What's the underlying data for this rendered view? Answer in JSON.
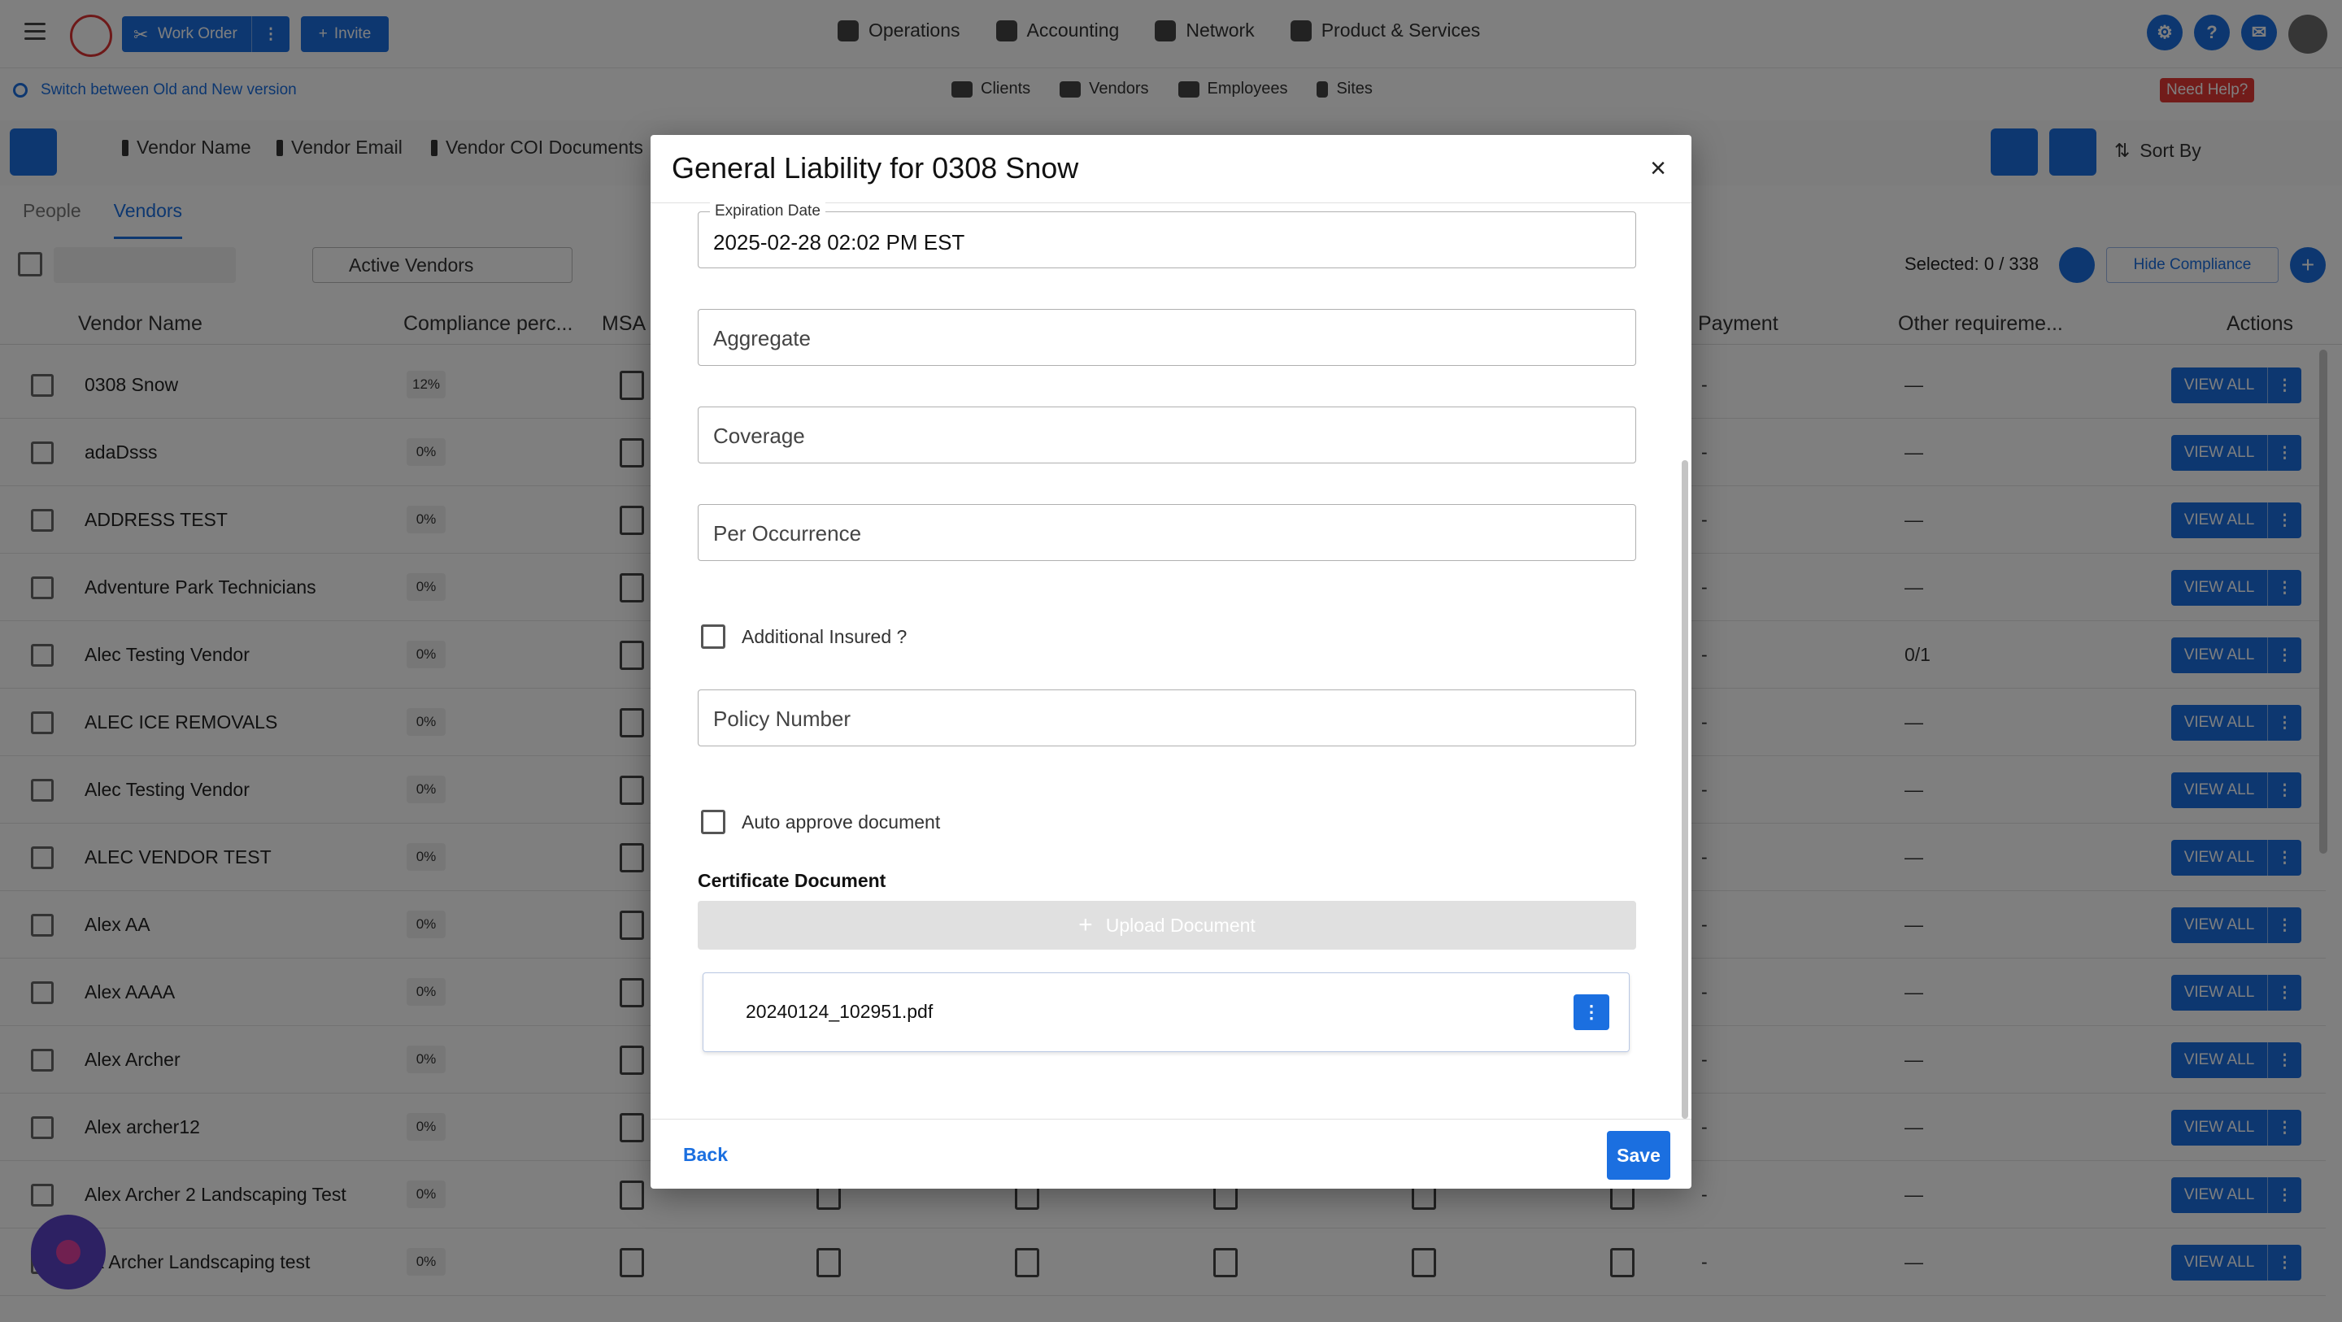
{
  "header": {
    "work_order_label": "Work Order",
    "work_order_menu": "⋮",
    "invite_label": "Invite",
    "nav": [
      {
        "label": "Operations",
        "icon": "clipboard-icon"
      },
      {
        "label": "Accounting",
        "icon": "ledger-icon"
      },
      {
        "label": "Network",
        "icon": "network-icon"
      },
      {
        "label": "Product & Services",
        "icon": "briefcase-icon"
      }
    ],
    "help_label": "?"
  },
  "switch_label": "Switch between Old and New version",
  "subnav": [
    "Clients",
    "Vendors",
    "Employees",
    "Sites"
  ],
  "need_help": "Need Help?",
  "pinned_columns": [
    "Vendor Name",
    "Vendor Email",
    "Vendor COI Documents"
  ],
  "sort_by": "Sort By",
  "tabs": [
    "People",
    "Vendors"
  ],
  "filter": {
    "active_vendors": "Active Vendors",
    "selected": "Selected: 0 / 338",
    "hide_compliance": "Hide Compliance"
  },
  "table": {
    "headers": {
      "vendor_name": "Vendor Name",
      "compliance": "Compliance perc...",
      "msa": "MSA",
      "payment": "Payment",
      "other": "Other requireme...",
      "actions": "Actions"
    },
    "view_all": "VIEW ALL",
    "rows": [
      {
        "name": "0308 Snow",
        "pct": "12%",
        "other": "—"
      },
      {
        "name": "adaDsss",
        "pct": "0%",
        "other": "—"
      },
      {
        "name": "ADDRESS TEST",
        "pct": "0%",
        "other": "—"
      },
      {
        "name": "Adventure Park Technicians",
        "pct": "0%",
        "other": "—"
      },
      {
        "name": "Alec Testing Vendor",
        "pct": "0%",
        "other": "0/1"
      },
      {
        "name": "ALEC ICE REMOVALS",
        "pct": "0%",
        "other": "—"
      },
      {
        "name": "Alec Testing Vendor",
        "pct": "0%",
        "other": "—"
      },
      {
        "name": "ALEC VENDOR TEST",
        "pct": "0%",
        "other": "—"
      },
      {
        "name": "Alex AA",
        "pct": "0%",
        "other": "—"
      },
      {
        "name": "Alex AAAA",
        "pct": "0%",
        "other": "—"
      },
      {
        "name": "Alex Archer",
        "pct": "0%",
        "other": "—"
      },
      {
        "name": "Alex archer12",
        "pct": "0%",
        "other": "—"
      },
      {
        "name": "Alex Archer 2 Landscaping Test",
        "pct": "0%",
        "other": "—"
      },
      {
        "name": "ex Archer Landscaping test",
        "pct": "0%",
        "other": "—"
      }
    ]
  },
  "modal": {
    "title": "General Liability for 0308 Snow",
    "close": "×",
    "expiration_label": "Expiration Date",
    "expiration_value": "2025-02-28 02:02 PM EST",
    "aggregate": "Aggregate",
    "coverage": "Coverage",
    "per_occurrence": "Per Occurrence",
    "additional_insured": "Additional Insured ?",
    "policy_number": "Policy Number",
    "auto_approve": "Auto approve document",
    "certificate_label": "Certificate Document",
    "upload_label": "Upload Document",
    "file_name": "20240124_102951.pdf",
    "file_menu": "⋮",
    "back": "Back",
    "save": "Save"
  }
}
